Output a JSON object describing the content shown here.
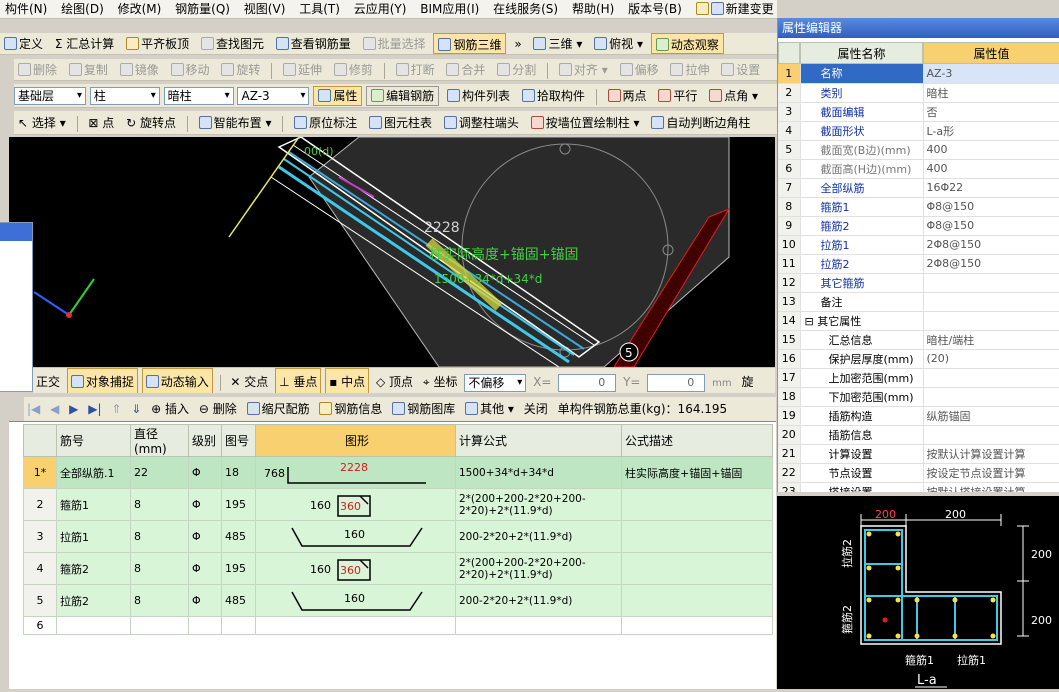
{
  "menu": [
    "构件(N)",
    "绘图(D)",
    "修改(M)",
    "钢筋量(Q)",
    "视图(V)",
    "工具(T)",
    "云应用(Y)",
    "BIM应用(I)",
    "在线服务(S)",
    "帮助(H)",
    "版本号(B)",
    "新建变更"
  ],
  "toolbar1": [
    "定义",
    "汇总计算",
    "平齐板顶",
    "查找图元",
    "查看钢筋量",
    "批量选择",
    "钢筋三维",
    "三维",
    "俯视",
    "动态观察"
  ],
  "toolbar2": [
    "删除",
    "复制",
    "镜像",
    "移动",
    "旋转",
    "延伸",
    "修剪",
    "打断",
    "合并",
    "分割",
    "对齐",
    "偏移",
    "拉伸",
    "设置"
  ],
  "toolbar3": {
    "layer": "基础层",
    "type": "柱",
    "subtype": "暗柱",
    "name": "AZ-3",
    "buttons": [
      "属性",
      "编辑钢筋",
      "构件列表",
      "拾取构件",
      "两点",
      "平行",
      "点角"
    ]
  },
  "toolbar4": [
    "选择",
    "点",
    "旋转点",
    "智能布置",
    "原位标注",
    "图元柱表",
    "调整柱端头",
    "按墙位置绘制柱",
    "自动判断边角柱"
  ],
  "canvas": {
    "label_length": "2228",
    "label_formula": "柱实际高度+锚固+锚固",
    "label_formula2": "1500+34*d+34*d",
    "label_top": "00(d)",
    "label_num": "5"
  },
  "snapbar": {
    "items": [
      "正交",
      "对象捕捉",
      "动态输入",
      "交点",
      "垂点",
      "中点",
      "顶点",
      "坐标"
    ],
    "offset": "不偏移",
    "x_label": "X=",
    "x_value": "0",
    "y_label": "Y=",
    "y_value": "0",
    "unit": "mm",
    "rotate": "旋"
  },
  "gridbar": {
    "items": [
      "插入",
      "删除",
      "缩尺配筋",
      "钢筋信息",
      "钢筋图库",
      "其他",
      "关闭"
    ],
    "total": "单构件钢筋总重(kg)：164.195"
  },
  "grid": {
    "headers": [
      "筋号",
      "直径(mm)",
      "级别",
      "图号",
      "图形",
      "计算公式",
      "公式描述"
    ],
    "rows": [
      {
        "num": "1*",
        "name": "全部纵筋.1",
        "dia": "22",
        "grade": "Φ",
        "fig": "18",
        "shape_a": "768",
        "shape_b": "2228",
        "formula": "1500+34*d+34*d",
        "desc": "柱实际高度+锚固+锚固"
      },
      {
        "num": "2",
        "name": "箍筋1",
        "dia": "8",
        "grade": "Φ",
        "fig": "195",
        "shape_a": "160",
        "shape_b": "360",
        "formula": "2*(200+200-2*20+200-2*20)+2*(11.9*d)",
        "desc": ""
      },
      {
        "num": "3",
        "name": "拉筋1",
        "dia": "8",
        "grade": "Φ",
        "fig": "485",
        "shape_a": "160",
        "shape_b": "",
        "formula": "200-2*20+2*(11.9*d)",
        "desc": ""
      },
      {
        "num": "4",
        "name": "箍筋2",
        "dia": "8",
        "grade": "Φ",
        "fig": "195",
        "shape_a": "160",
        "shape_b": "360",
        "formula": "2*(200+200-2*20+200-2*20)+2*(11.9*d)",
        "desc": ""
      },
      {
        "num": "5",
        "name": "拉筋2",
        "dia": "8",
        "grade": "Φ",
        "fig": "485",
        "shape_a": "160",
        "shape_b": "",
        "formula": "200-2*20+2*(11.9*d)",
        "desc": ""
      },
      {
        "num": "6",
        "name": "",
        "dia": "",
        "grade": "",
        "fig": "",
        "shape_a": "",
        "shape_b": "",
        "formula": "",
        "desc": ""
      }
    ]
  },
  "props": {
    "title": "属性编辑器",
    "col_name": "属性名称",
    "col_value": "属性值",
    "rows": [
      {
        "n": "1",
        "name": "名称",
        "value": "AZ-3",
        "style": "sel"
      },
      {
        "n": "2",
        "name": "类别",
        "value": "暗柱",
        "style": "blue"
      },
      {
        "n": "3",
        "name": "截面编辑",
        "value": "否",
        "style": "blue"
      },
      {
        "n": "4",
        "name": "截面形状",
        "value": "L-a形",
        "style": "blue"
      },
      {
        "n": "5",
        "name": "截面宽(B边)(mm)",
        "value": "400",
        "style": "grey"
      },
      {
        "n": "6",
        "name": "截面高(H边)(mm)",
        "value": "400",
        "style": "grey"
      },
      {
        "n": "7",
        "name": "全部纵筋",
        "value": "16Φ22",
        "style": "blue"
      },
      {
        "n": "8",
        "name": "箍筋1",
        "value": "Φ8@150",
        "style": "blue"
      },
      {
        "n": "9",
        "name": "箍筋2",
        "value": "Φ8@150",
        "style": "blue"
      },
      {
        "n": "10",
        "name": "拉筋1",
        "value": "2Φ8@150",
        "style": "blue"
      },
      {
        "n": "11",
        "name": "拉筋2",
        "value": "2Φ8@150",
        "style": "blue"
      },
      {
        "n": "12",
        "name": "其它箍筋",
        "value": "",
        "style": "blue"
      },
      {
        "n": "13",
        "name": "备注",
        "value": "",
        "style": ""
      },
      {
        "n": "14",
        "name": "其它属性",
        "value": "",
        "style": "group"
      },
      {
        "n": "15",
        "name": "汇总信息",
        "value": "暗柱/端柱",
        "style": "sub"
      },
      {
        "n": "16",
        "name": "保护层厚度(mm)",
        "value": "(20)",
        "style": "sub"
      },
      {
        "n": "17",
        "name": "上加密范围(mm)",
        "value": "",
        "style": "sub"
      },
      {
        "n": "18",
        "name": "下加密范围(mm)",
        "value": "",
        "style": "sub"
      },
      {
        "n": "19",
        "name": "插筋构造",
        "value": "纵筋锚固",
        "style": "sub"
      },
      {
        "n": "20",
        "name": "插筋信息",
        "value": "",
        "style": "sub"
      },
      {
        "n": "21",
        "name": "计算设置",
        "value": "按默认计算设置计算",
        "style": "sub"
      },
      {
        "n": "22",
        "name": "节点设置",
        "value": "按设定节点设置计算",
        "style": "sub"
      },
      {
        "n": "23",
        "name": "搭接设置",
        "value": "按默认搭接设置计算",
        "style": "sub"
      }
    ]
  },
  "preview": {
    "dim1": "200",
    "dim2": "200",
    "dim3": "200",
    "dim4": "200",
    "lbl_la2": "拉筋2",
    "lbl_gu2": "箍筋2",
    "lbl_gu1": "箍筋1",
    "lbl_la1": "拉筋1",
    "shape": "L-a"
  }
}
